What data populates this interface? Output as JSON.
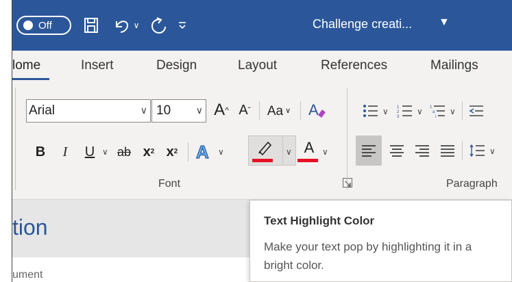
{
  "titlebar": {
    "autosave_state": "Off",
    "doc_title": "Challenge creati...",
    "icons": [
      "save-icon",
      "undo-icon",
      "redo-icon",
      "customize-qat-icon",
      "title-dropdown-icon"
    ],
    "color": "#2b579a"
  },
  "tabs": [
    {
      "label": "lome",
      "active": true
    },
    {
      "label": "Insert"
    },
    {
      "label": "Design"
    },
    {
      "label": "Layout"
    },
    {
      "label": "References"
    },
    {
      "label": "Mailings"
    }
  ],
  "font_group": {
    "font_name": "Arial",
    "font_size": "10",
    "group_label": "Font",
    "bold": "B",
    "italic": "I",
    "underline": "U",
    "strikethrough": "ab",
    "subscript": "x",
    "superscript": "x",
    "grow": "A",
    "shrink": "A",
    "change_case": "Aa",
    "font_color": "A",
    "highlight_color": "#e81123",
    "font_color_bar": "#e81123"
  },
  "paragraph_group": {
    "group_label": "Paragraph"
  },
  "document": {
    "heading_fragment": "tion",
    "line_fragment": "ument"
  },
  "tooltip": {
    "title": "Text Highlight Color",
    "body": "Make your text pop by highlighting it in a bright color."
  }
}
